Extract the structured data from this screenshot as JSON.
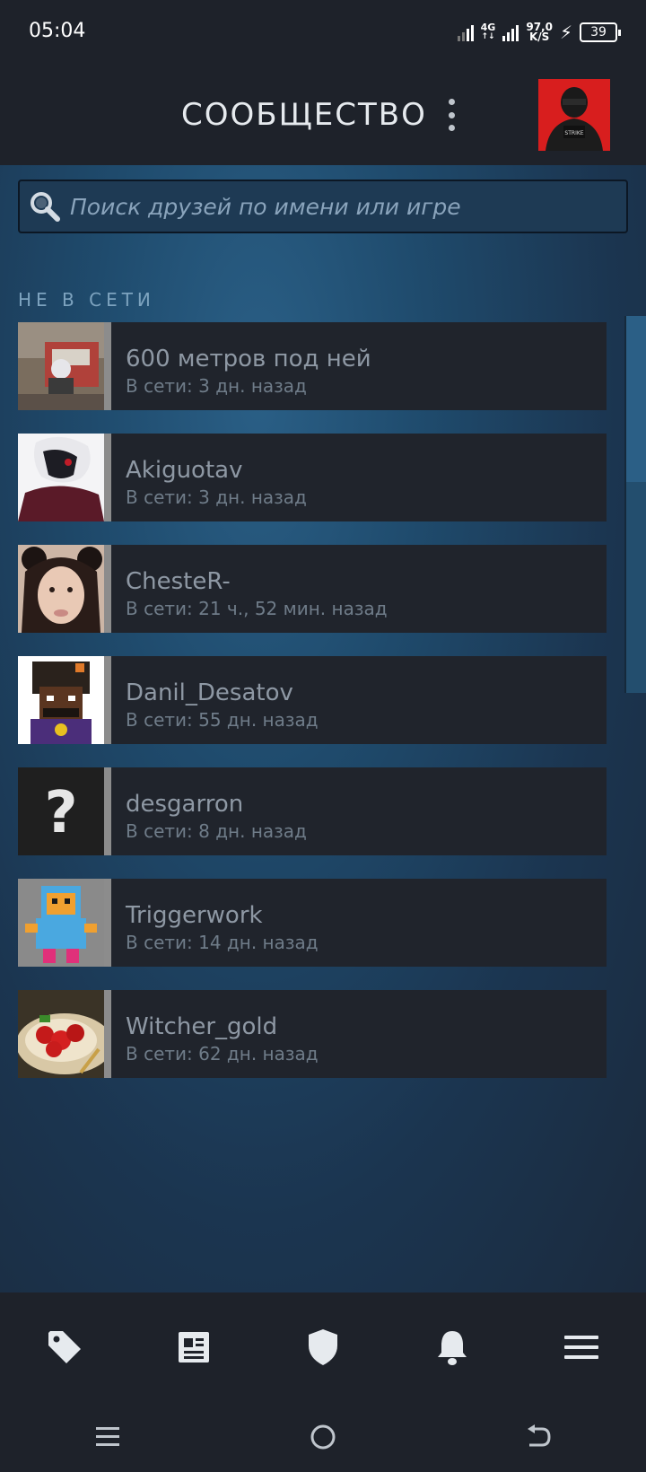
{
  "status_bar": {
    "time": "05:04",
    "network": "4G",
    "speed_value": "97,0",
    "speed_unit": "K/S",
    "battery": "39"
  },
  "header": {
    "title": "СООБЩЕСТВО"
  },
  "search": {
    "placeholder": "Поиск друзей по имени или игре"
  },
  "section": {
    "label": "НЕ В СЕТИ"
  },
  "friends": [
    {
      "name": "600 метров под ней",
      "status": "В сети: 3 дн. назад"
    },
    {
      "name": "Akiguotav",
      "status": "В сети: 3 дн. назад"
    },
    {
      "name": "ChesteR-",
      "status": "В сети: 21 ч., 52 мин. назад"
    },
    {
      "name": "Danil_Desatov",
      "status": "В сети: 55 дн. назад"
    },
    {
      "name": "desgarron",
      "status": "В сети: 8 дн. назад"
    },
    {
      "name": "Triggerwork",
      "status": "В сети: 14 дн. назад"
    },
    {
      "name": "Witcher_gold",
      "status": "В сети: 62 дн. назад"
    }
  ],
  "bottom_nav": [
    "tag-icon",
    "news-icon",
    "shield-icon",
    "bell-icon",
    "menu-icon"
  ],
  "colors": {
    "background": "#1b2838",
    "bar": "#1e222a",
    "card": "#20242c",
    "offline_indicator": "#8c8c8c"
  }
}
